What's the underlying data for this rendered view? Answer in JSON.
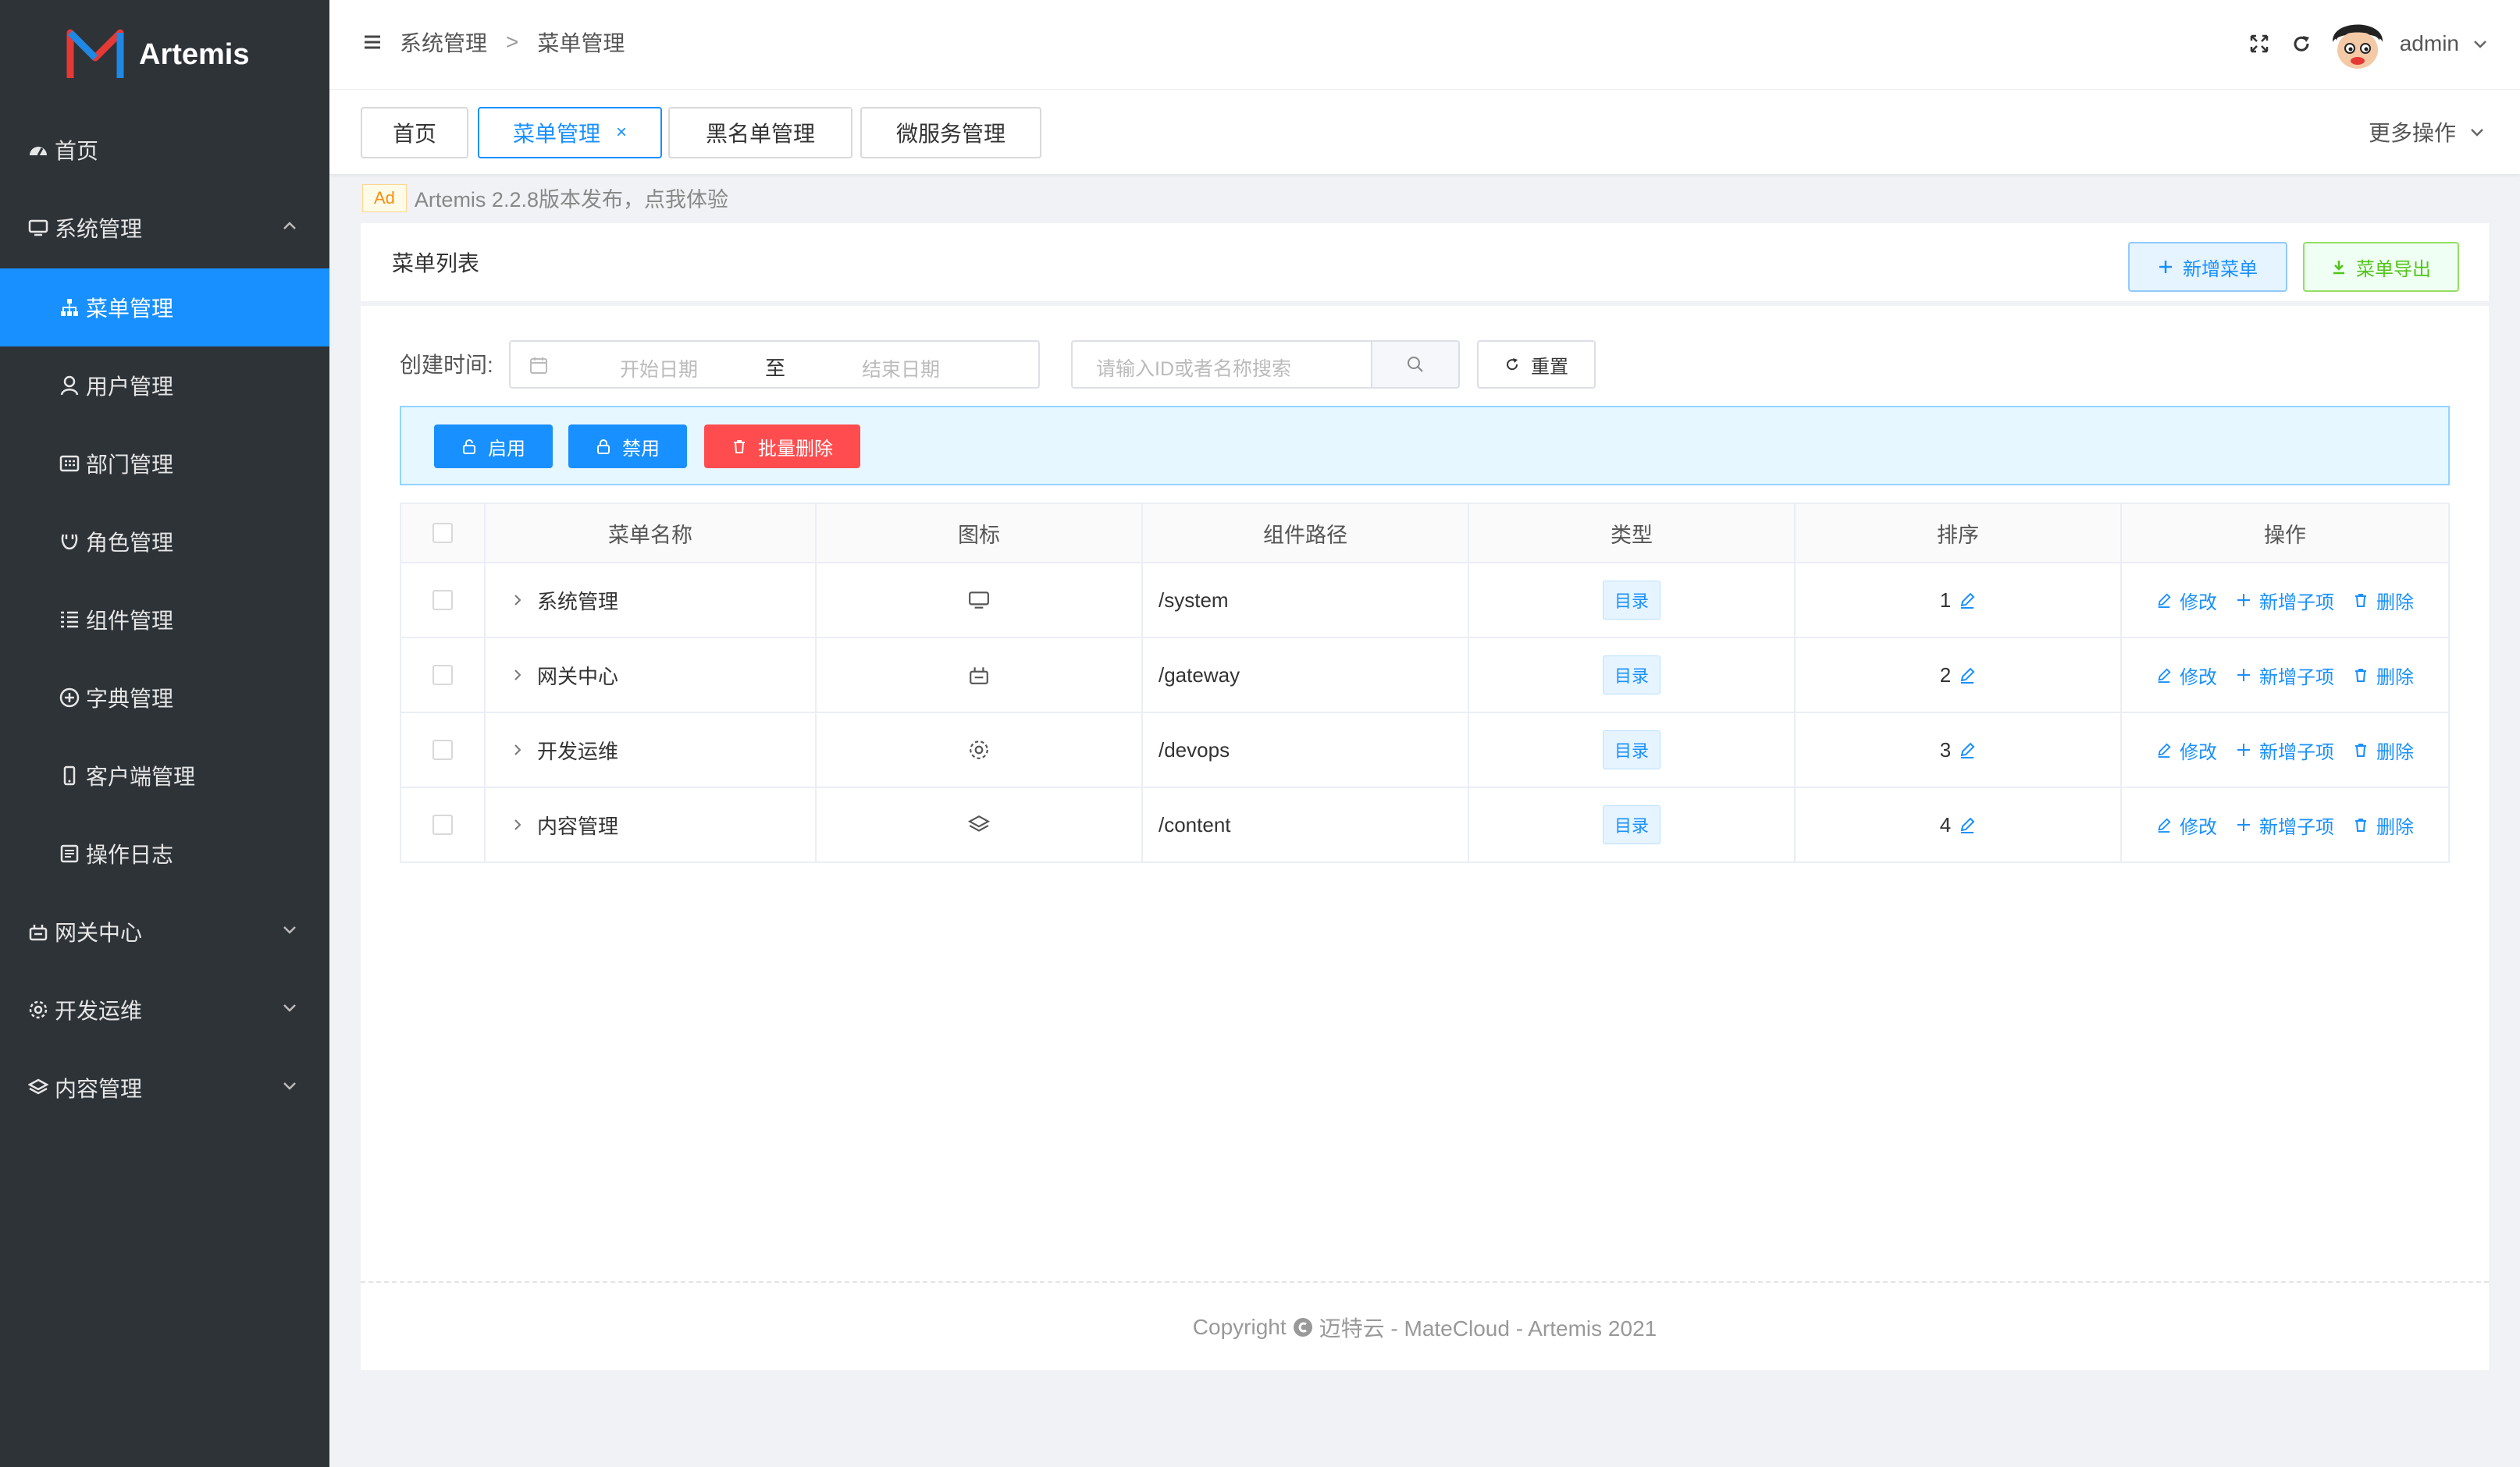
{
  "app": {
    "name": "Artemis"
  },
  "sidebar": {
    "items": [
      {
        "label": "首页",
        "icon": "dashboard-icon"
      },
      {
        "label": "系统管理",
        "icon": "monitor-icon",
        "expanded": true
      },
      {
        "label": "菜单管理",
        "icon": "tree-icon",
        "active": true
      },
      {
        "label": "用户管理",
        "icon": "user-icon"
      },
      {
        "label": "部门管理",
        "icon": "building-icon"
      },
      {
        "label": "角色管理",
        "icon": "role-icon"
      },
      {
        "label": "组件管理",
        "icon": "component-icon"
      },
      {
        "label": "字典管理",
        "icon": "dict-icon"
      },
      {
        "label": "客户端管理",
        "icon": "mobile-icon"
      },
      {
        "label": "操作日志",
        "icon": "log-icon"
      },
      {
        "label": "网关中心",
        "icon": "gateway-icon"
      },
      {
        "label": "开发运维",
        "icon": "gear-icon"
      },
      {
        "label": "内容管理",
        "icon": "layers-icon"
      }
    ]
  },
  "header": {
    "breadcrumb": [
      "系统管理",
      "菜单管理"
    ],
    "breadcrumb_sep": ">",
    "user": "admin"
  },
  "tabs": {
    "items": [
      {
        "label": "首页"
      },
      {
        "label": "菜单管理",
        "active": true,
        "close": "×"
      },
      {
        "label": "黑名单管理"
      },
      {
        "label": "微服务管理"
      }
    ],
    "more": "更多操作"
  },
  "ad": {
    "badge": "Ad",
    "text": "Artemis 2.2.8版本发布，点我体验"
  },
  "card": {
    "title": "菜单列表",
    "add_label": "新增菜单",
    "export_label": "菜单导出"
  },
  "filter": {
    "label": "创建时间:",
    "start_placeholder": "开始日期",
    "range_sep": "至",
    "end_placeholder": "结束日期",
    "search_placeholder": "请输入ID或者名称搜索",
    "reset_label": "重置"
  },
  "actions": {
    "enable": "启用",
    "disable": "禁用",
    "batch_delete": "批量删除",
    "colors": {
      "primary": "#1890ff",
      "danger": "#ff4d4f"
    }
  },
  "table": {
    "headers": [
      "菜单名称",
      "图标",
      "组件路径",
      "类型",
      "排序",
      "操作"
    ],
    "rows": [
      {
        "name": "系统管理",
        "icon": "monitor-icon",
        "path": "/system",
        "type": "目录",
        "sort": "1"
      },
      {
        "name": "网关中心",
        "icon": "gateway-icon",
        "path": "/gateway",
        "type": "目录",
        "sort": "2"
      },
      {
        "name": "开发运维",
        "icon": "gear-icon",
        "path": "/devops",
        "type": "目录",
        "sort": "3"
      },
      {
        "name": "内容管理",
        "icon": "layers-icon",
        "path": "/content",
        "type": "目录",
        "sort": "4"
      }
    ],
    "ops": {
      "edit": "修改",
      "add_child": "新增子项",
      "delete": "删除"
    }
  },
  "footer": {
    "prefix": "Copyright",
    "text": "迈特云 - MateCloud - Artemis 2021"
  }
}
